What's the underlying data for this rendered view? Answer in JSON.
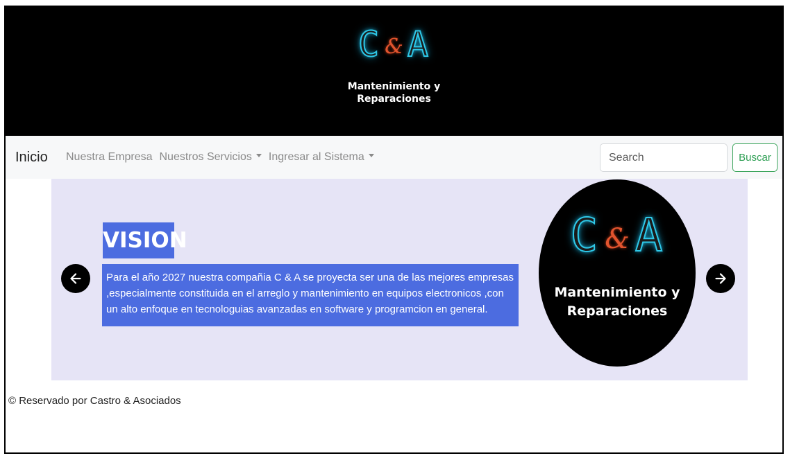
{
  "header": {
    "logo_letter_1": "C",
    "logo_amp": "&",
    "logo_letter_2": "A",
    "subtitle_line1": "Mantenimiento y",
    "subtitle_line2": "Reparaciones"
  },
  "navbar": {
    "brand": "Inicio",
    "links": [
      {
        "label": "Nuestra Empresa",
        "dropdown": false
      },
      {
        "label": "Nuestros Servicios",
        "dropdown": true
      },
      {
        "label": "Ingresar al Sistema",
        "dropdown": true
      }
    ],
    "search_placeholder": "Search",
    "search_button": "Buscar"
  },
  "carousel": {
    "slide_title": "VISION",
    "slide_text": "Para el año 2027 nuestra compañia C & A se proyecta ser una de las mejores empresas ,especialmente constituida en el arreglo y mantenimiento en equipos electronicos ,con un alto enfoque en tecnologuias avanzadas en software y programcion en general.",
    "prev_icon": "arrow-left-icon",
    "next_icon": "arrow-right-icon",
    "logo": {
      "letter_1": "C",
      "amp": "&",
      "letter_2": "A",
      "subtitle_line1": "Mantenimiento y",
      "subtitle_line2": "Reparaciones"
    }
  },
  "footer": {
    "text": "© Reservado por Castro & Asociados"
  },
  "colors": {
    "neon_blue": "#2ec8e8",
    "amp_orange": "#e2542e",
    "slide_blue": "#4c6ce0",
    "carousel_bg": "#e6e4f6",
    "button_green": "#2c9e52"
  }
}
